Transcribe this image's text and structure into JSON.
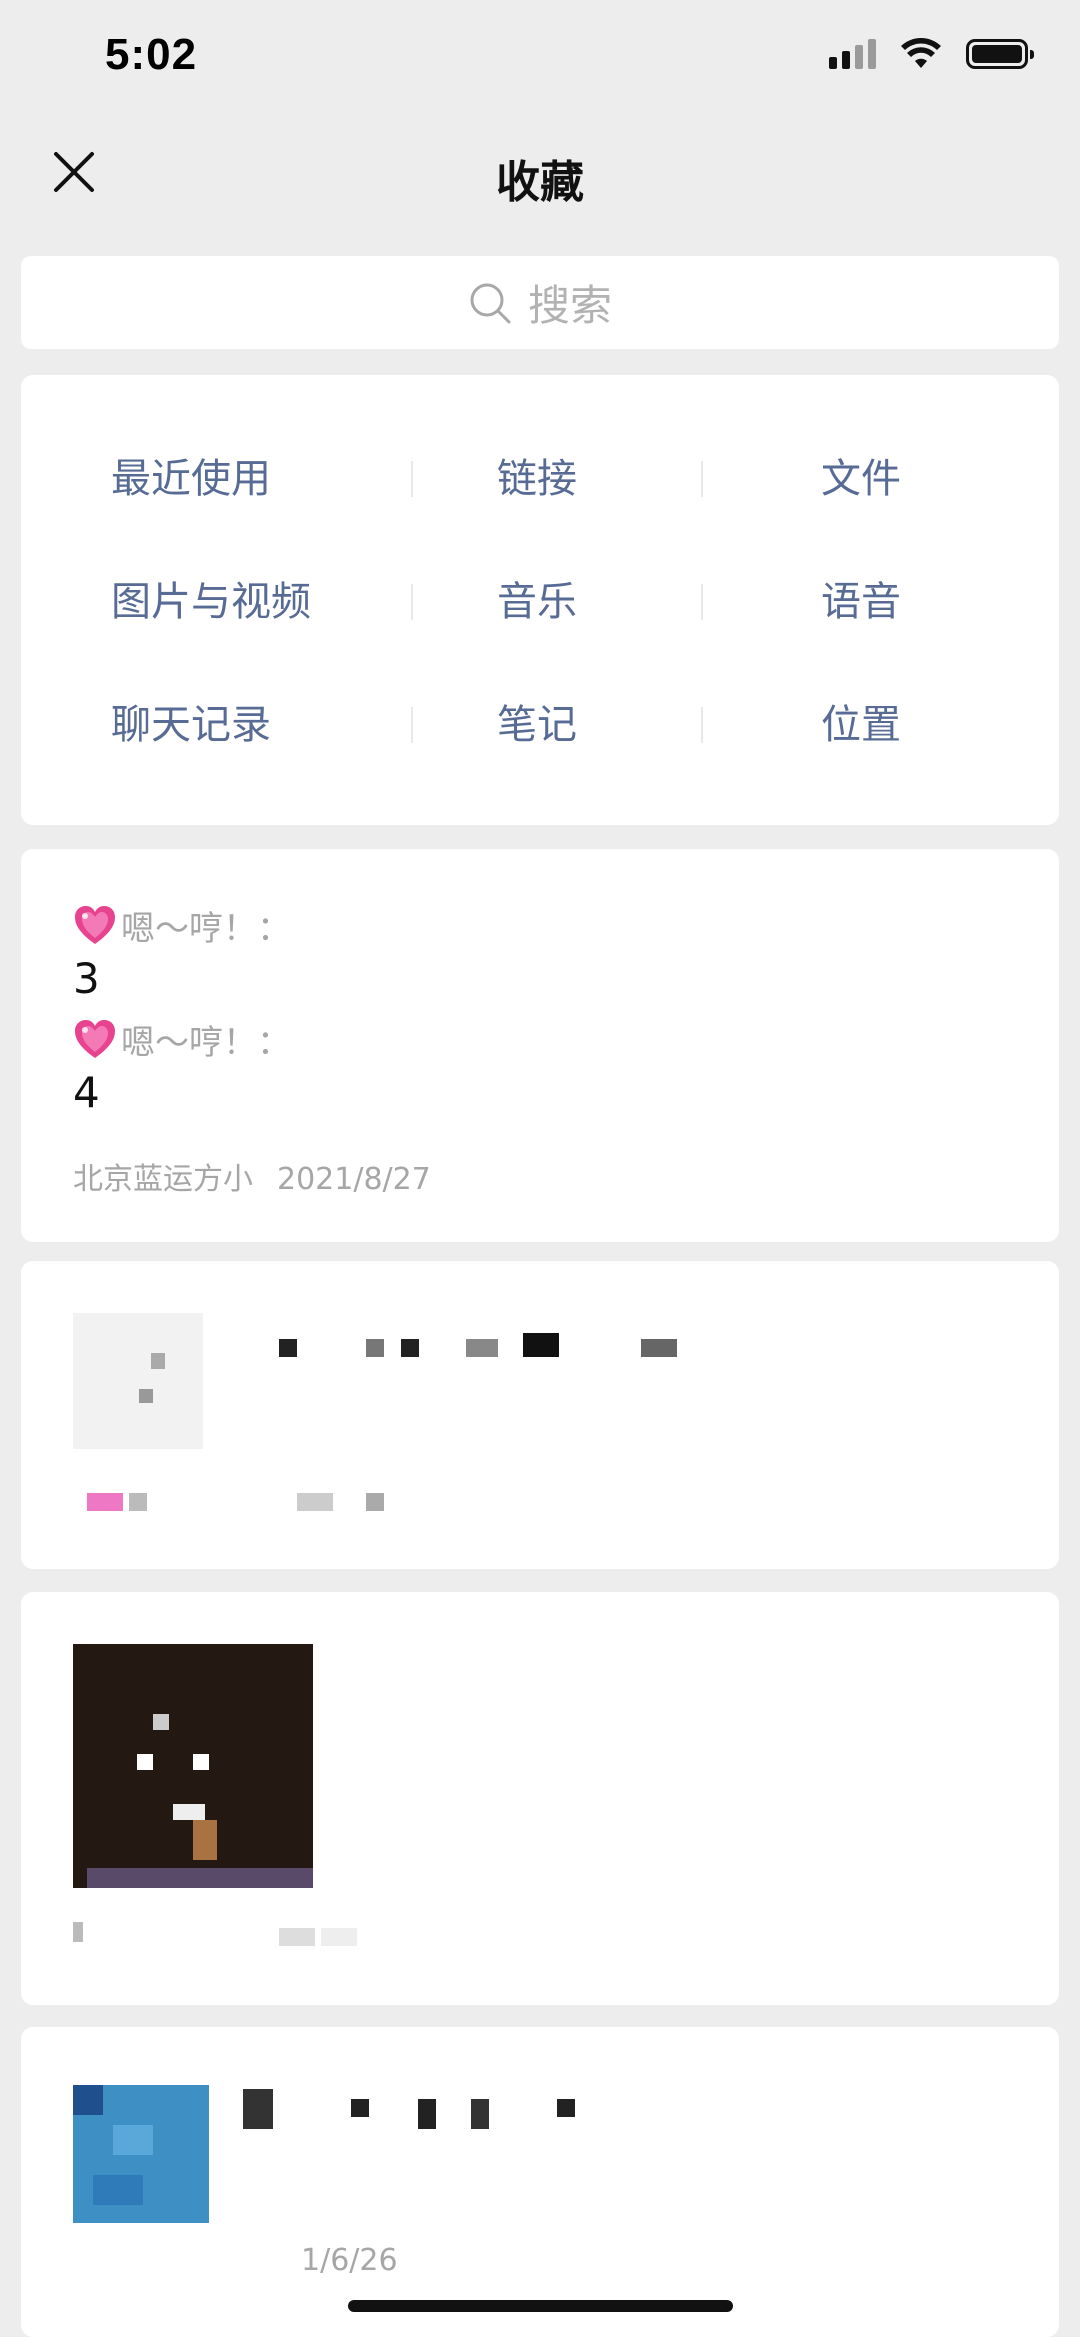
{
  "status_bar": {
    "time": "5:02"
  },
  "nav": {
    "title": "收藏",
    "close_icon": "close-icon"
  },
  "search": {
    "placeholder": "搜索",
    "icon": "search-icon"
  },
  "categories": {
    "row1": [
      "最近使用",
      "链接",
      "文件"
    ],
    "row2": [
      "图片与视频",
      "音乐",
      "语音"
    ],
    "row3": [
      "聊天记录",
      "笔记",
      "位置"
    ]
  },
  "favorites": [
    {
      "type": "chat-record",
      "lines": [
        {
          "sender": "嗯～哼！：",
          "value": "3"
        },
        {
          "sender": "嗯～哼！：",
          "value": "4"
        }
      ],
      "source": "北京蓝运方小",
      "date": "2021/8/27"
    },
    {
      "type": "link-redacted"
    },
    {
      "type": "image-redacted"
    },
    {
      "type": "link-redacted",
      "date_partial": "1/6/26"
    }
  ],
  "colors": {
    "background": "#ededed",
    "card": "#ffffff",
    "category_text": "#576b95",
    "meta_text": "#a6a6a6"
  }
}
